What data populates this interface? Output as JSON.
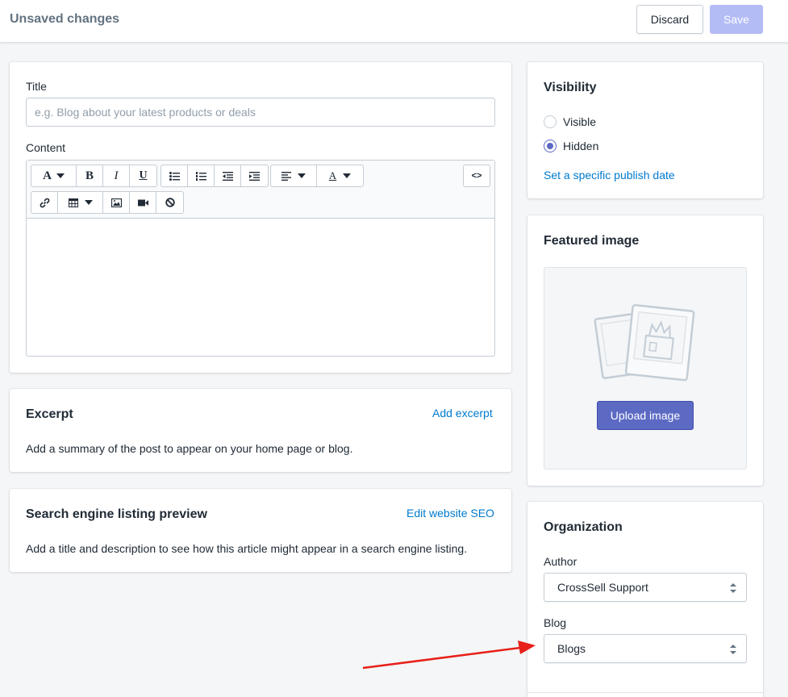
{
  "topbar": {
    "title": "Unsaved changes",
    "discard_label": "Discard",
    "save_label": "Save"
  },
  "post": {
    "title_label": "Title",
    "title_placeholder": "e.g. Blog about your latest products or deals",
    "title_value": "",
    "content_label": "Content",
    "toolbar_icons": [
      "font-icon",
      "bold-icon",
      "italic-icon",
      "underline-icon",
      "bullet-list-icon",
      "numbered-list-icon",
      "outdent-icon",
      "indent-icon",
      "align-left-icon",
      "text-color-icon",
      "html-code-icon",
      "link-icon",
      "table-icon",
      "image-icon",
      "video-icon",
      "clear-format-icon"
    ],
    "toolbar_glyphs": {
      "font": "A",
      "bold": "B",
      "italic": "I",
      "underline": "U",
      "code": "<>"
    }
  },
  "excerpt": {
    "heading": "Excerpt",
    "action": "Add excerpt",
    "description": "Add a summary of the post to appear on your home page or blog."
  },
  "seo": {
    "heading": "Search engine listing preview",
    "action": "Edit website SEO",
    "description": "Add a title and description to see how this article might appear in a search engine listing."
  },
  "visibility": {
    "heading": "Visibility",
    "options": [
      {
        "label": "Visible",
        "selected": false
      },
      {
        "label": "Hidden",
        "selected": true
      }
    ],
    "publish_link": "Set a specific publish date"
  },
  "featured_image": {
    "heading": "Featured image",
    "upload_label": "Upload image"
  },
  "organization": {
    "heading": "Organization",
    "author_label": "Author",
    "author_value": "CrossSell Support",
    "blog_label": "Blog",
    "blog_value": "Blogs"
  },
  "colors": {
    "accent": "#5c6ac4",
    "link": "#007ace",
    "save_disabled": "#b3bcf5",
    "annotation_arrow": "#e8201a"
  }
}
